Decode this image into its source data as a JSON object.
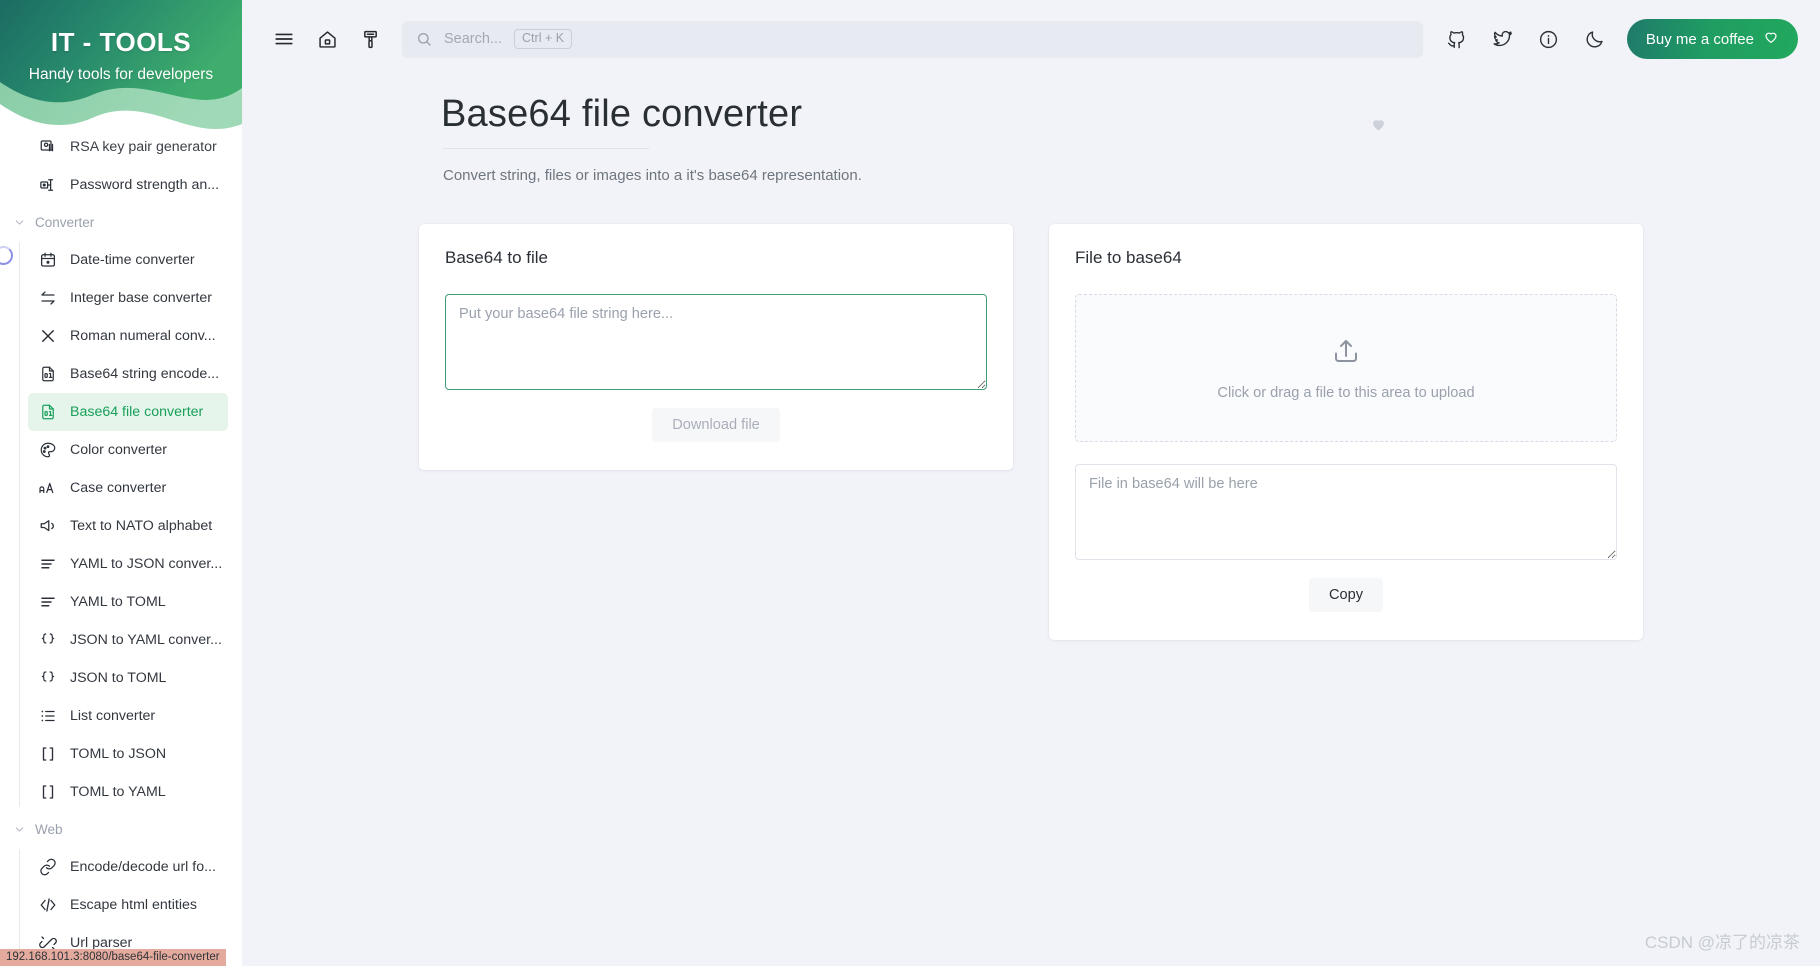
{
  "brand": {
    "title": "IT - TOOLS",
    "subtitle": "Handy tools for developers"
  },
  "colors": {
    "accent": "#18a058",
    "accent_soft": "#e5f5ec",
    "banner_from": "#1b6f64",
    "banner_to": "#3faf6e",
    "page_bg": "#f1f3f8",
    "card_bg": "#ffffff",
    "text": "#2a2f36",
    "muted": "#9aa1ad",
    "status_url_bg": "#e4aa9e"
  },
  "topbar": {
    "menu_toggle_label": "menu-icon",
    "home_label": "home-icon",
    "theme_paint_label": "brush-icon",
    "search": {
      "placeholder": "Search...",
      "shortcut": "Ctrl + K",
      "value": ""
    },
    "github_label": "github-icon",
    "twitter_label": "twitter-icon",
    "info_label": "info-icon",
    "darkmode_label": "moon-icon",
    "coffee_button": "Buy me a coffee"
  },
  "page": {
    "title": "Base64 file converter",
    "subtitle": "Convert string, files or images into a it's base64 representation.",
    "favorite_label": "heart-icon"
  },
  "cards": [
    {
      "id": "base64-to-file",
      "title": "Base64 to file",
      "textarea": {
        "placeholder": "Put your base64 file string here...",
        "value": ""
      },
      "button": "Download file",
      "button_disabled": true
    },
    {
      "id": "file-to-base64",
      "title": "File to base64",
      "dropzone": {
        "text": "Click or drag a file to this area to upload",
        "icon": "upload-icon"
      },
      "textarea": {
        "placeholder": "File in base64 will be here",
        "value": ""
      },
      "button": "Copy",
      "button_disabled": false
    }
  ],
  "sidebar": {
    "top_items": [
      {
        "label": "RSA key pair generator",
        "icon": "certificate-icon",
        "active": false
      },
      {
        "label": "Password strength an...",
        "icon": "password-icon",
        "active": false
      }
    ],
    "groups": [
      {
        "label": "Converter",
        "expanded": true,
        "items": [
          {
            "label": "Date-time converter",
            "icon": "calendar-icon",
            "active": false
          },
          {
            "label": "Integer base converter",
            "icon": "arrows-swap-icon",
            "active": false
          },
          {
            "label": "Roman numeral conv...",
            "icon": "roman-x-icon",
            "active": false
          },
          {
            "label": "Base64 string encode...",
            "icon": "file-binary-icon",
            "active": false
          },
          {
            "label": "Base64 file converter",
            "icon": "file-binary-icon",
            "active": true
          },
          {
            "label": "Color converter",
            "icon": "palette-icon",
            "active": false
          },
          {
            "label": "Case converter",
            "icon": "letter-case-icon",
            "active": false
          },
          {
            "label": "Text to NATO alphabet",
            "icon": "megaphone-icon",
            "active": false
          },
          {
            "label": "YAML to JSON conver...",
            "icon": "lines-icon",
            "active": false
          },
          {
            "label": "YAML to TOML",
            "icon": "lines-icon",
            "active": false
          },
          {
            "label": "JSON to YAML conver...",
            "icon": "braces-icon",
            "active": false
          },
          {
            "label": "JSON to TOML",
            "icon": "braces-icon",
            "active": false
          },
          {
            "label": "List converter",
            "icon": "list-icon",
            "active": false
          },
          {
            "label": "TOML to JSON",
            "icon": "brackets-icon",
            "active": false
          },
          {
            "label": "TOML to YAML",
            "icon": "brackets-icon",
            "active": false
          }
        ]
      },
      {
        "label": "Web",
        "expanded": true,
        "items": [
          {
            "label": "Encode/decode url fo...",
            "icon": "link-icon",
            "active": false
          },
          {
            "label": "Escape html entities",
            "icon": "code-icon",
            "active": false
          },
          {
            "label": "Url parser",
            "icon": "link-broken-icon",
            "active": false
          }
        ]
      }
    ]
  },
  "status": {
    "url": "192.168.101.3:8080/base64-file-converter"
  },
  "watermark": "CSDN @凉了的凉茶"
}
